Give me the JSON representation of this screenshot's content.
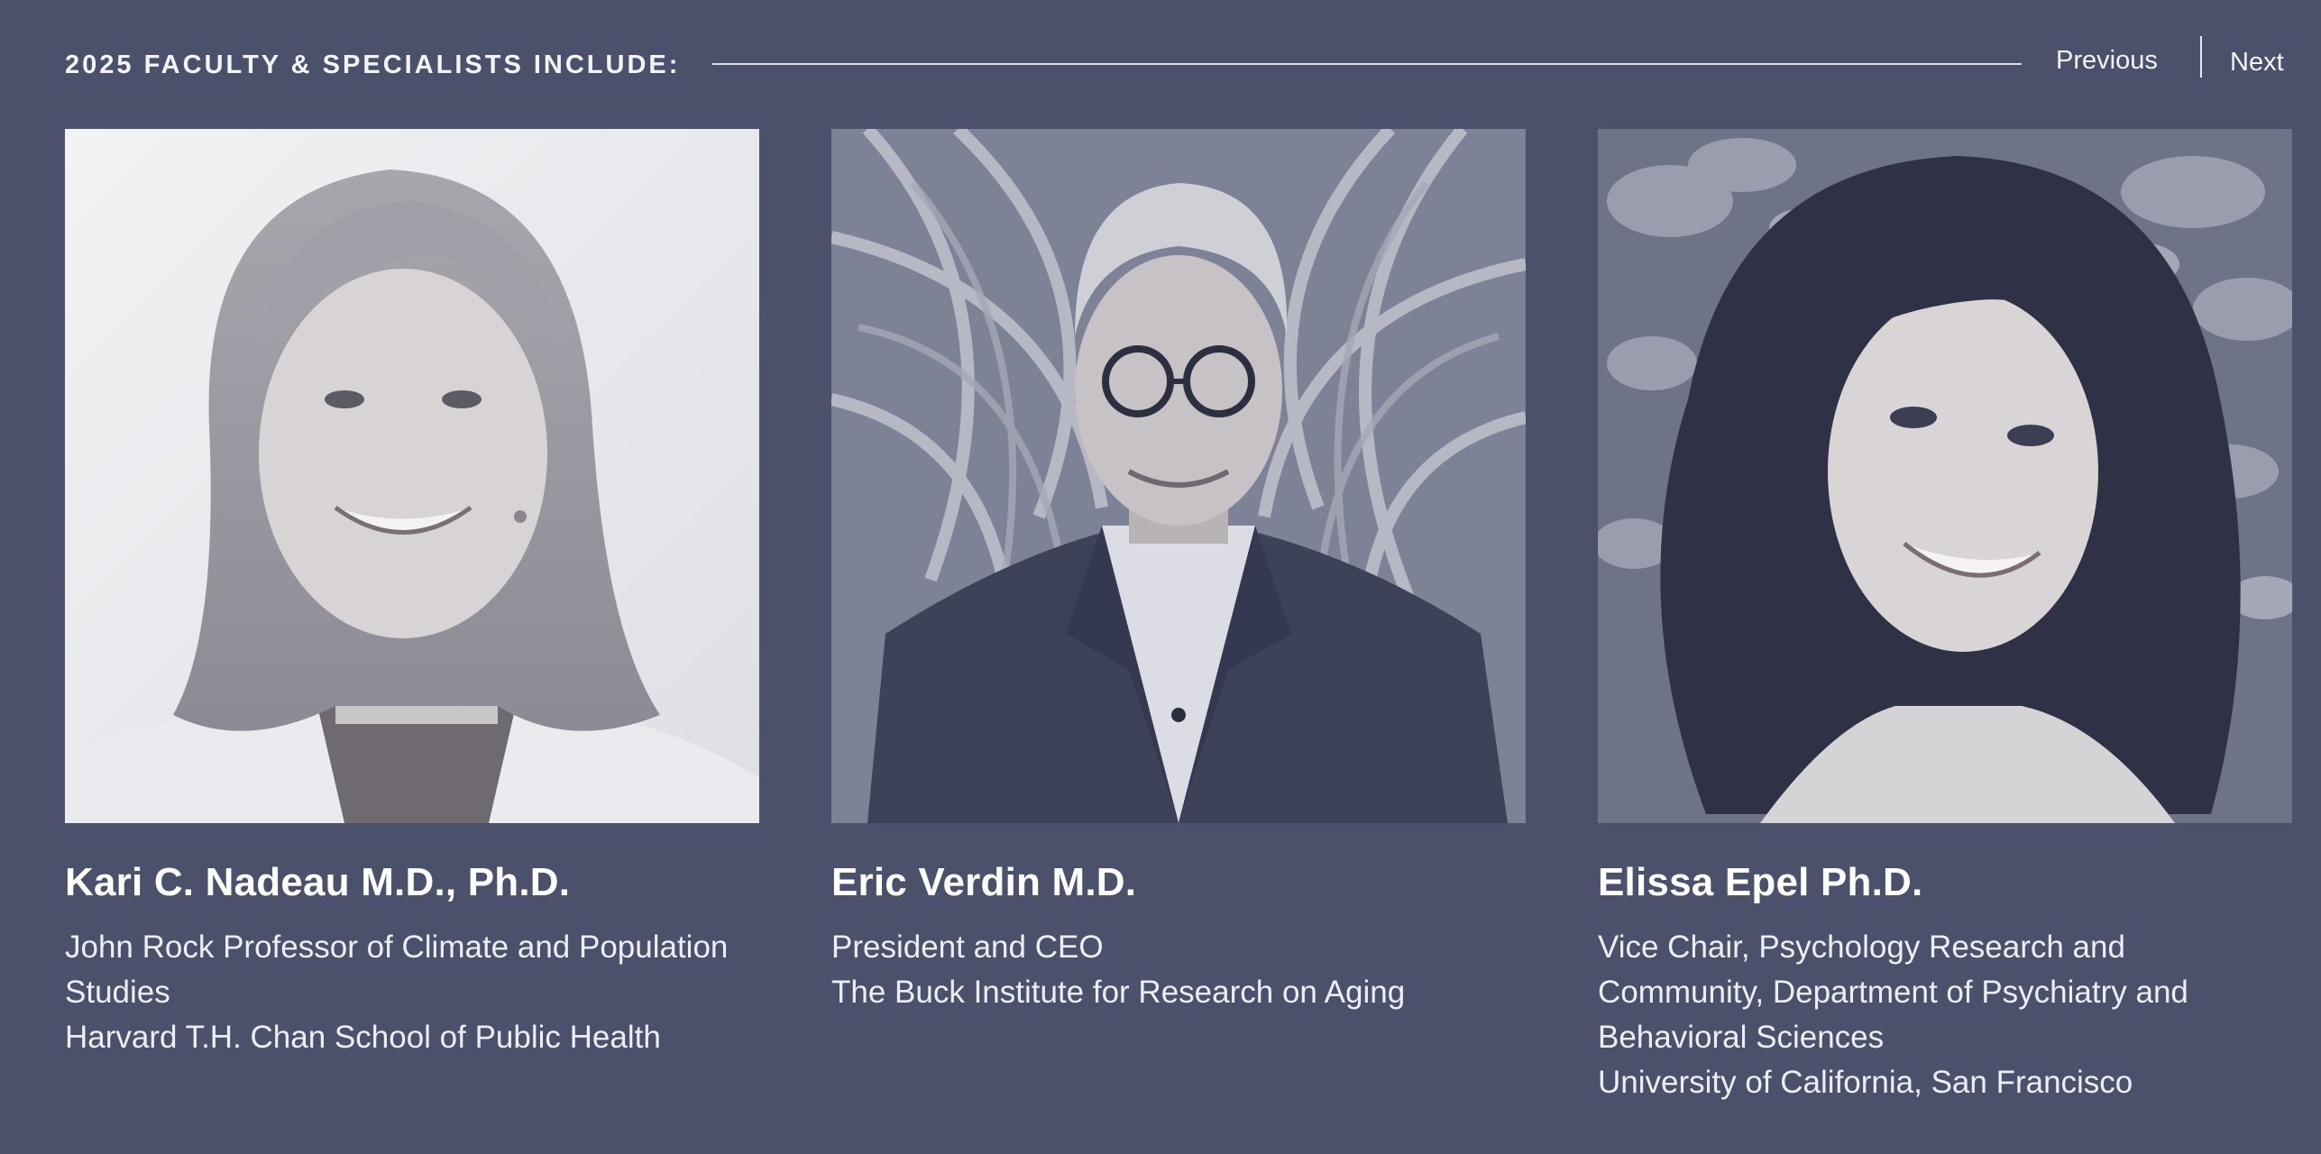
{
  "header": {
    "title": "2025 FACULTY & SPECIALISTS INCLUDE:",
    "previous_label": "Previous",
    "next_label": "Next"
  },
  "faculty": [
    {
      "name": "Kari C. Nadeau M.D., Ph.D.",
      "title": "John Rock Professor of Climate and Population Studies",
      "institution": "Harvard T.H. Chan School of Public Health"
    },
    {
      "name": "Eric Verdin M.D.",
      "title": "President and CEO",
      "institution": "The Buck Institute for Research on Aging"
    },
    {
      "name": "Elissa Epel Ph.D.",
      "title": "Vice Chair, Psychology Research and Community, Department of Psychiatry and Behavioral Sciences",
      "institution": "University of California, San Francisco"
    }
  ],
  "colors": {
    "background": "#4b506b",
    "text": "#f3f3f6",
    "photo_tint": "#5a5f78"
  }
}
